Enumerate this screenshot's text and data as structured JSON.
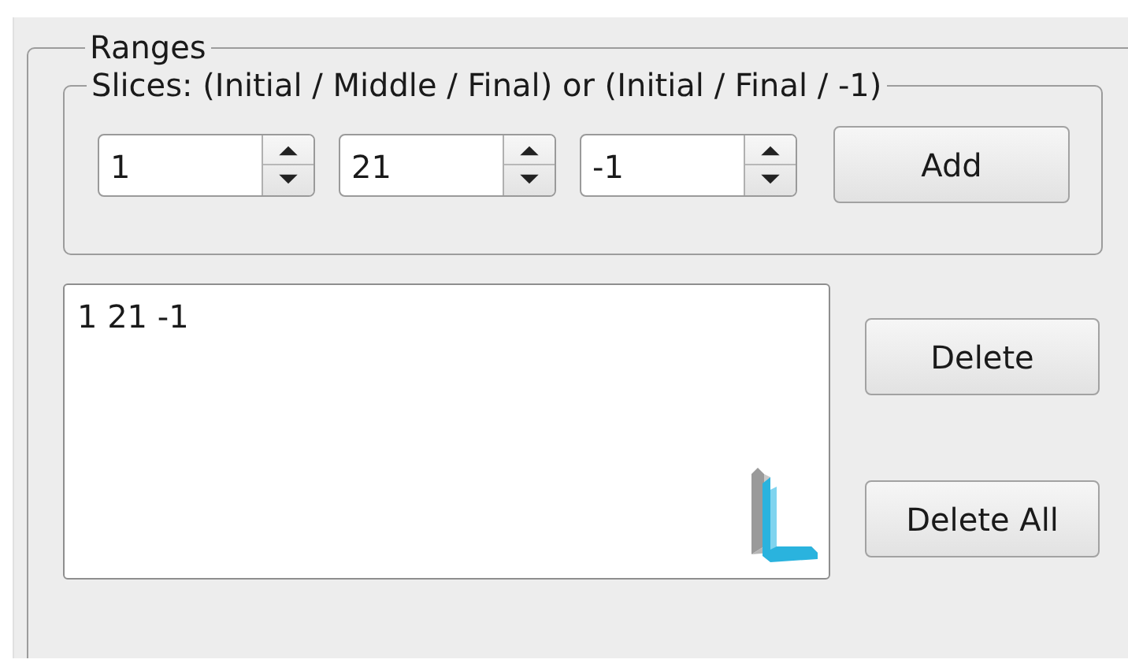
{
  "ranges": {
    "title": "Ranges",
    "slices": {
      "title": "Slices: (Initial / Middle / Final) or (Initial / Final / -1)",
      "spinboxes": [
        {
          "value": "1"
        },
        {
          "value": "21"
        },
        {
          "value": "-1"
        }
      ],
      "add_button": "Add"
    },
    "list": {
      "items": [
        "1 21 -1"
      ]
    },
    "buttons": [
      "Delete",
      "Delete All"
    ]
  }
}
